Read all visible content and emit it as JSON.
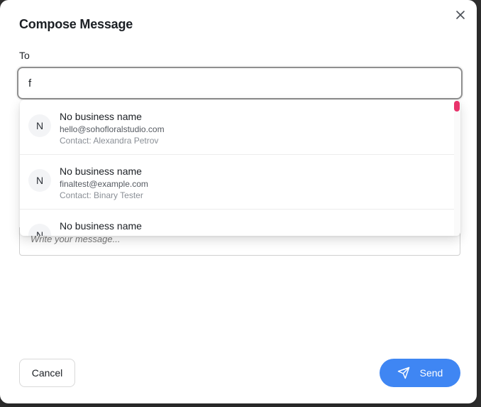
{
  "modal": {
    "title": "Compose Message",
    "close_icon": "close-icon"
  },
  "to_field": {
    "label": "To",
    "value": "f"
  },
  "suggestions": [
    {
      "avatar": "N",
      "name": "No business name",
      "email": "hello@sohofloralstudio.com",
      "contact": "Contact: Alexandra Petrov"
    },
    {
      "avatar": "N",
      "name": "No business name",
      "email": "finaltest@example.com",
      "contact": "Contact: Binary Tester"
    },
    {
      "avatar": "N",
      "name": "No business name",
      "email": "",
      "contact": ""
    }
  ],
  "message": {
    "placeholder": "Write your message..."
  },
  "actions": {
    "cancel_label": "Cancel",
    "send_label": "Send",
    "send_icon": "send-icon"
  },
  "colors": {
    "send_button": "#3f86f3",
    "scrollbar_thumb": "#e8336b"
  }
}
